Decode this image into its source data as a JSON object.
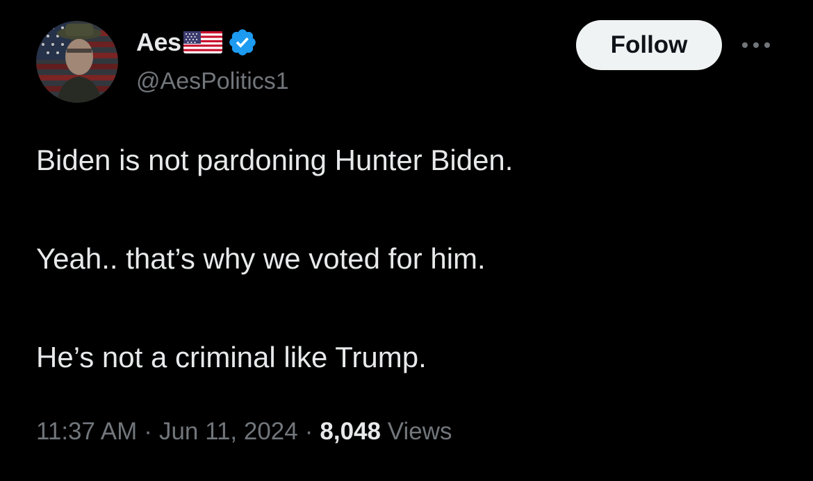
{
  "author": {
    "display_name": "Aes",
    "handle": "@AesPolitics1",
    "flag_icon": "us-flag-icon",
    "verified_icon": "verified-badge-icon",
    "verified_color": "#1d9bf0"
  },
  "actions": {
    "follow_label": "Follow",
    "more_icon": "more-options-icon"
  },
  "tweet": {
    "lines": [
      "Biden is not pardoning Hunter Biden.",
      "Yeah.. that’s why we voted for him.",
      "He’s not a criminal like Trump."
    ]
  },
  "meta": {
    "time": "11:37 AM",
    "separator": "·",
    "date": "Jun 11, 2024",
    "views_count": "8,048",
    "views_label": "Views"
  },
  "colors": {
    "background": "#000000",
    "primary_text": "#e7e9ea",
    "secondary_text": "#71767b",
    "follow_bg": "#eff3f4",
    "follow_text": "#0f1419"
  }
}
